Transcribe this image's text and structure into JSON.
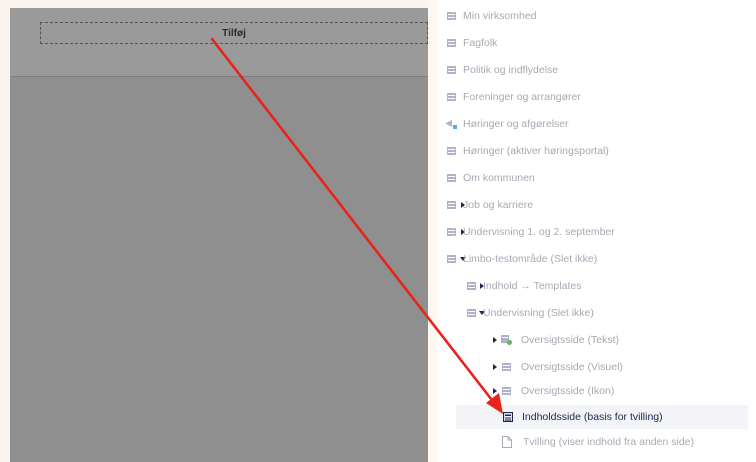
{
  "editor": {
    "add_label": "Tilføj"
  },
  "tree": {
    "items": [
      {
        "label": "Min virksomhed",
        "icon": "document-icon"
      },
      {
        "label": "Fagfolk",
        "icon": "document-icon"
      },
      {
        "label": "Politik og indflydelse",
        "icon": "document-icon"
      },
      {
        "label": "Foreninger og arrangører",
        "icon": "document-icon"
      },
      {
        "label": "Høringer og afgørelser",
        "icon": "megaphone-icon"
      },
      {
        "label": "Høringer (aktiver høringsportal)",
        "icon": "document-icon"
      },
      {
        "label": "Om kommunen",
        "icon": "document-icon"
      },
      {
        "label": "Job og karriere",
        "icon": "document-icon"
      },
      {
        "label": "Undervisning 1. og 2. september",
        "icon": "document-icon"
      },
      {
        "label": "Limbo-testområde (Slet ikke)",
        "icon": "document-icon"
      },
      {
        "label": "Indhold → Templates",
        "icon": "document-icon"
      },
      {
        "label": "Undervisning (Slet ikke)",
        "icon": "document-icon"
      },
      {
        "label": "Oversigtsside (Tekst)",
        "icon": "document-plus-icon"
      },
      {
        "label": "Oversigtsside (Visuel)",
        "icon": "document-icon"
      },
      {
        "label": "Oversigtsside (Ikon)",
        "icon": "document-icon"
      },
      {
        "label": "Indholdsside (basis for tvilling)",
        "icon": "content-page-icon"
      },
      {
        "label": "Tvilling (viser indhold fra anden side)",
        "icon": "page-copy-icon"
      }
    ]
  },
  "colors": {
    "active_text": "#1b264f",
    "muted_text": "#a7a9b4",
    "annotation_arrow": "#e8231b",
    "overlay": "#8f8f8f"
  }
}
